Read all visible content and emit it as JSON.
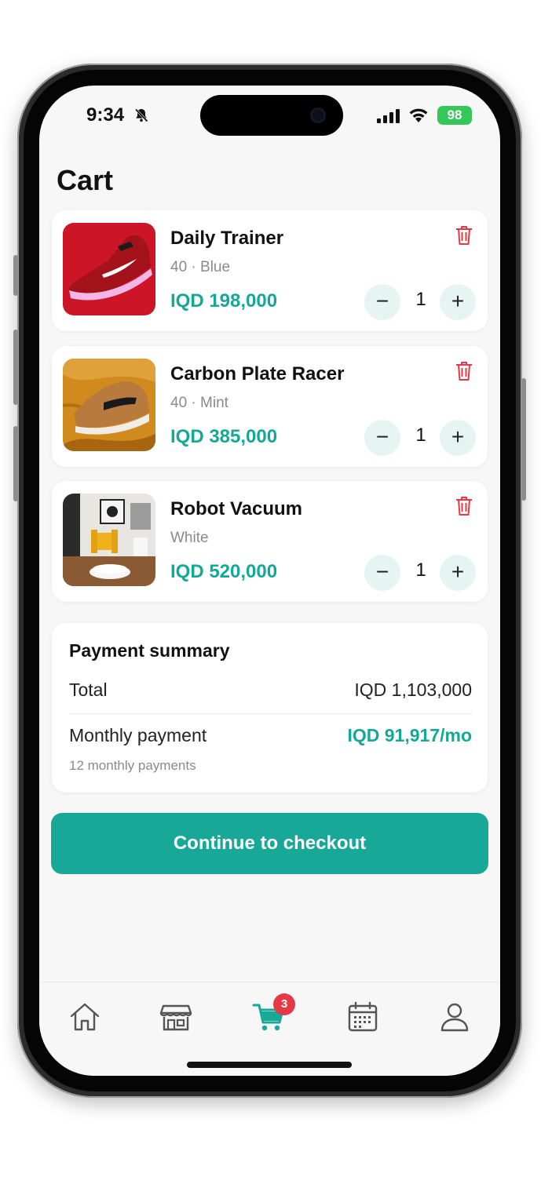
{
  "status": {
    "time": "9:34",
    "battery": "98"
  },
  "page": {
    "title": "Cart"
  },
  "items": [
    {
      "name": "Daily Trainer",
      "variant": "40 · Blue",
      "price": "IQD 198,000",
      "qty": "1",
      "thumb": "red-running-shoe"
    },
    {
      "name": "Carbon Plate Racer",
      "variant": "40 · Mint",
      "price": "IQD 385,000",
      "qty": "1",
      "thumb": "tan-sneaker-on-fabric"
    },
    {
      "name": "Robot Vacuum",
      "variant": "White",
      "price": "IQD 520,000",
      "qty": "1",
      "thumb": "robot-vacuum-living-room"
    }
  ],
  "controls": {
    "minus": "−",
    "plus": "+"
  },
  "summary": {
    "title": "Payment summary",
    "total_label": "Total",
    "total_value": "IQD 1,103,000",
    "monthly_label": "Monthly payment",
    "monthly_value": "IQD 91,917/mo",
    "note": "12 monthly payments"
  },
  "checkout": {
    "label": "Continue to checkout"
  },
  "tabbar": {
    "cart_badge": "3",
    "tabs": [
      "home-icon",
      "store-icon",
      "cart-icon",
      "calendar-icon",
      "profile-icon"
    ]
  },
  "colors": {
    "accent": "#17a898",
    "delete": "#e53945",
    "qty_bg": "#e6f5f2"
  }
}
